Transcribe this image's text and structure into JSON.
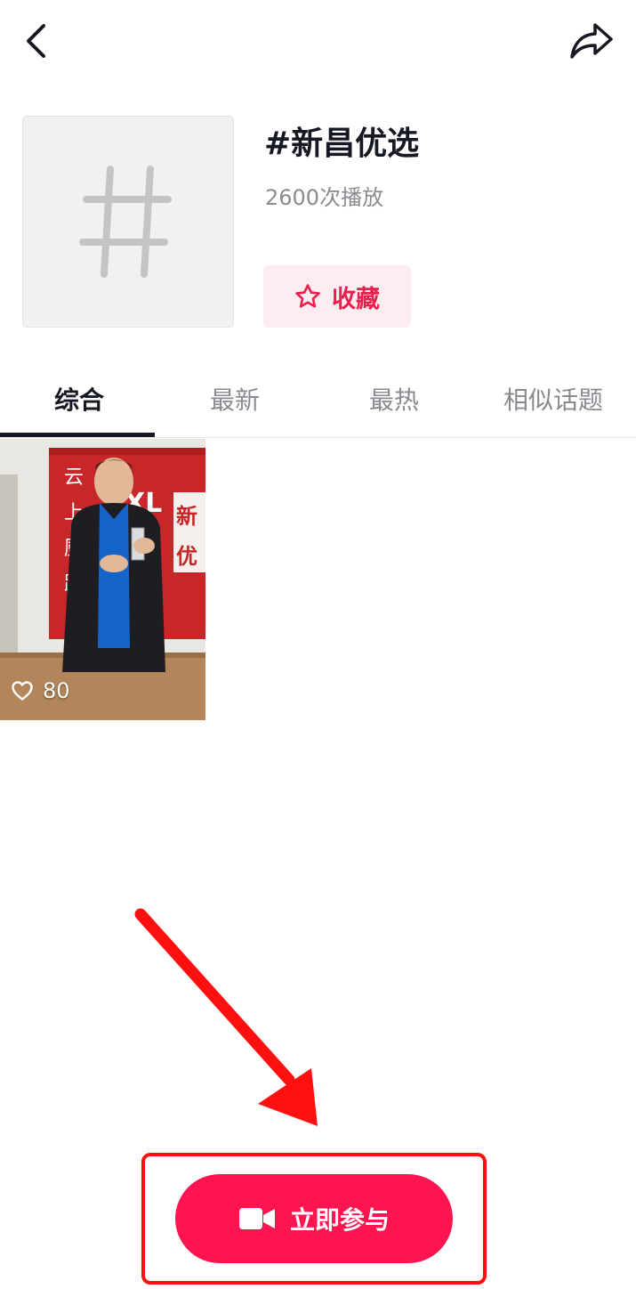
{
  "topic": {
    "title": "#新昌优选",
    "plays": "2600次播放",
    "favorite_label": "收藏"
  },
  "tabs": [
    {
      "label": "综合",
      "active": true
    },
    {
      "label": "最新",
      "active": false
    },
    {
      "label": "最热",
      "active": false
    },
    {
      "label": "相似话题",
      "active": false
    }
  ],
  "videos": [
    {
      "likes": "80"
    }
  ],
  "join_button": {
    "label": "立即参与"
  },
  "colors": {
    "accent": "#fe1550",
    "favorite_text": "#e8204d",
    "favorite_bg": "#fdecf0",
    "annotation": "#ff1010"
  },
  "icons": {
    "back": "chevron-left-icon",
    "share": "share-icon",
    "cover": "hashtag-icon",
    "favorite": "star-icon",
    "like": "heart-icon",
    "camera": "video-camera-icon"
  }
}
